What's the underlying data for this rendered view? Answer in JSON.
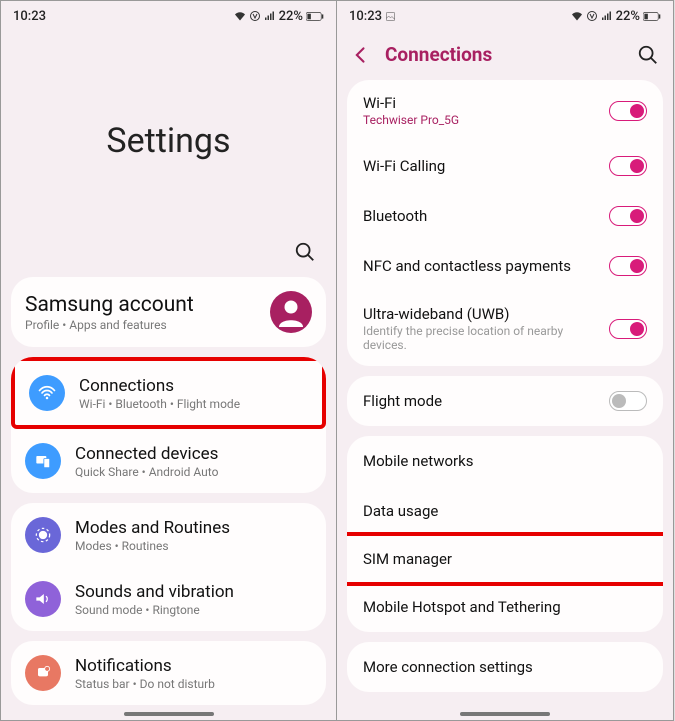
{
  "status": {
    "time": "10:23",
    "battery": "22%"
  },
  "left": {
    "title": "Settings",
    "account": {
      "title": "Samsung account",
      "sub": "Profile  •  Apps and features"
    },
    "rows": [
      {
        "title": "Connections",
        "sub": "Wi-Fi  •  Bluetooth  •  Flight mode",
        "icon": "wifi",
        "color": "#3e9cff",
        "hl": true
      },
      {
        "title": "Connected devices",
        "sub": "Quick Share  •  Android Auto",
        "icon": "devices",
        "color": "#3e9cff"
      }
    ],
    "rows2": [
      {
        "title": "Modes and Routines",
        "sub": "Modes  •  Routines",
        "icon": "modes",
        "color": "#6a67d8"
      },
      {
        "title": "Sounds and vibration",
        "sub": "Sound mode  •  Ringtone",
        "icon": "sound",
        "color": "#8f62d9"
      }
    ],
    "rows3": [
      {
        "title": "Notifications",
        "sub": "Status bar  •  Do not disturb",
        "icon": "notif",
        "color": "#e87863"
      }
    ]
  },
  "right": {
    "header": "Connections",
    "g1": [
      {
        "title": "Wi-Fi",
        "sub": "Techwiser Pro_5G",
        "subcolor": "accent",
        "toggle": "on"
      },
      {
        "title": "Wi-Fi Calling",
        "toggle": "on"
      },
      {
        "title": "Bluetooth",
        "toggle": "on"
      },
      {
        "title": "NFC and contactless payments",
        "toggle": "on"
      },
      {
        "title": "Ultra-wideband (UWB)",
        "sub": "Identify the precise location of nearby devices.",
        "subcolor": "gray",
        "toggle": "on"
      }
    ],
    "g2": [
      {
        "title": "Flight mode",
        "toggle": "off"
      }
    ],
    "g3": [
      {
        "title": "Mobile networks"
      },
      {
        "title": "Data usage"
      },
      {
        "title": "SIM manager",
        "hl": true
      },
      {
        "title": "Mobile Hotspot and Tethering"
      }
    ],
    "g4": [
      {
        "title": "More connection settings"
      }
    ]
  },
  "accent": "#a82061",
  "toggle_accent": "#d81b7a",
  "highlight": "#e60000"
}
